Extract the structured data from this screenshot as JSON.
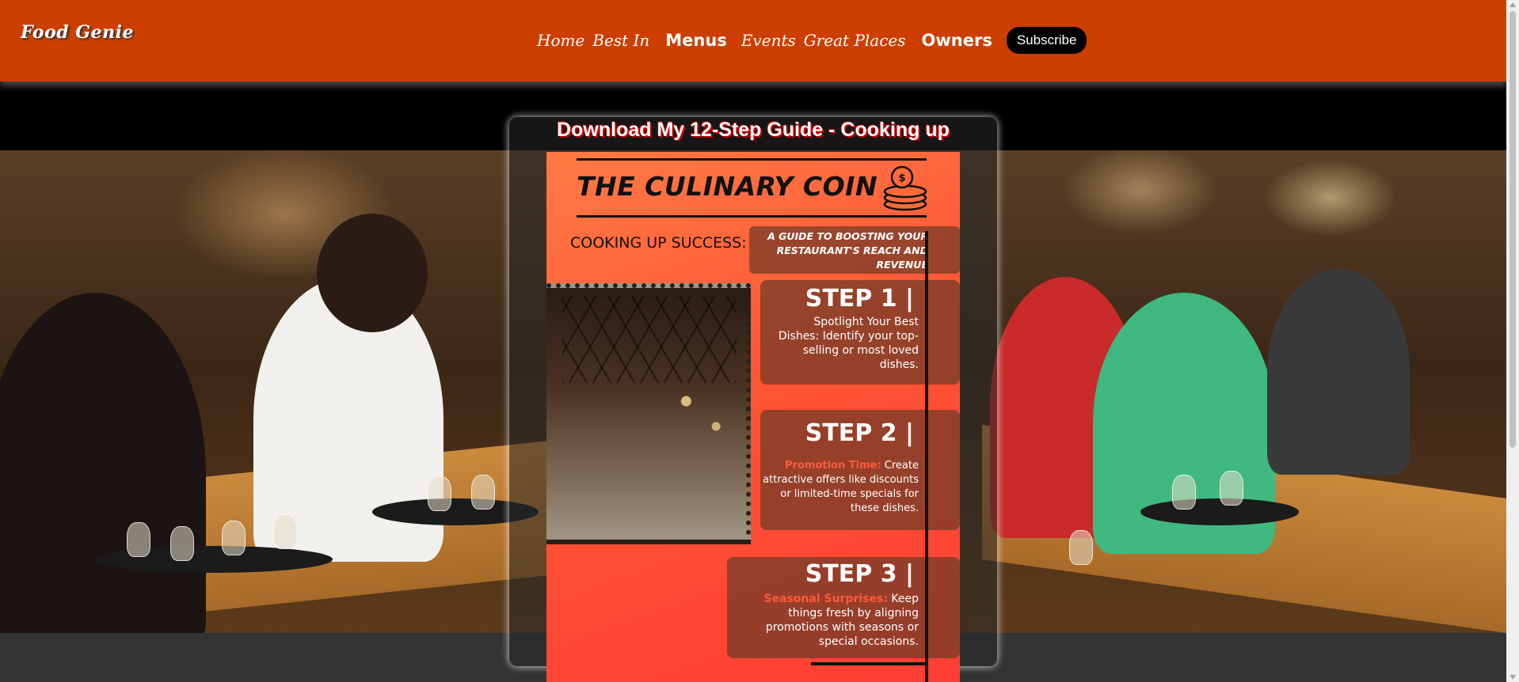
{
  "header": {
    "logo": "Food Genie",
    "nav": [
      {
        "label": "Home"
      },
      {
        "label": "Best In"
      },
      {
        "label": "Menus"
      },
      {
        "label": "Events"
      },
      {
        "label": "Great Places"
      },
      {
        "label": "Owners"
      }
    ],
    "subscribe_label": "Subscribe"
  },
  "modal": {
    "title": "Download My 12-Step Guide - Cooking up",
    "flyer": {
      "title": "THE CULINARY COIN",
      "subtitle_left": "COOKING UP SUCCESS:",
      "subtitle_right": "A GUIDE TO BOOSTING YOUR RESTAURANT'S REACH AND REVENUE",
      "steps": [
        {
          "heading": "STEP 1 |",
          "highlight": "",
          "text": "Spotlight Your Best Dishes: Identify your top-selling or most loved dishes."
        },
        {
          "heading": "STEP 2 |",
          "highlight": "Promotion Time:",
          "text": "Create attractive offers like discounts or limited-time specials for these dishes."
        },
        {
          "heading": "STEP 3 |",
          "highlight": "Seasonal Surprises:",
          "text": "Keep things fresh by aligning promotions with seasons or special occasions."
        }
      ]
    }
  },
  "colors": {
    "header_bg": "#cc3f00",
    "flyer_bg": "#ff5535",
    "highlight": "#ff5a3a"
  }
}
